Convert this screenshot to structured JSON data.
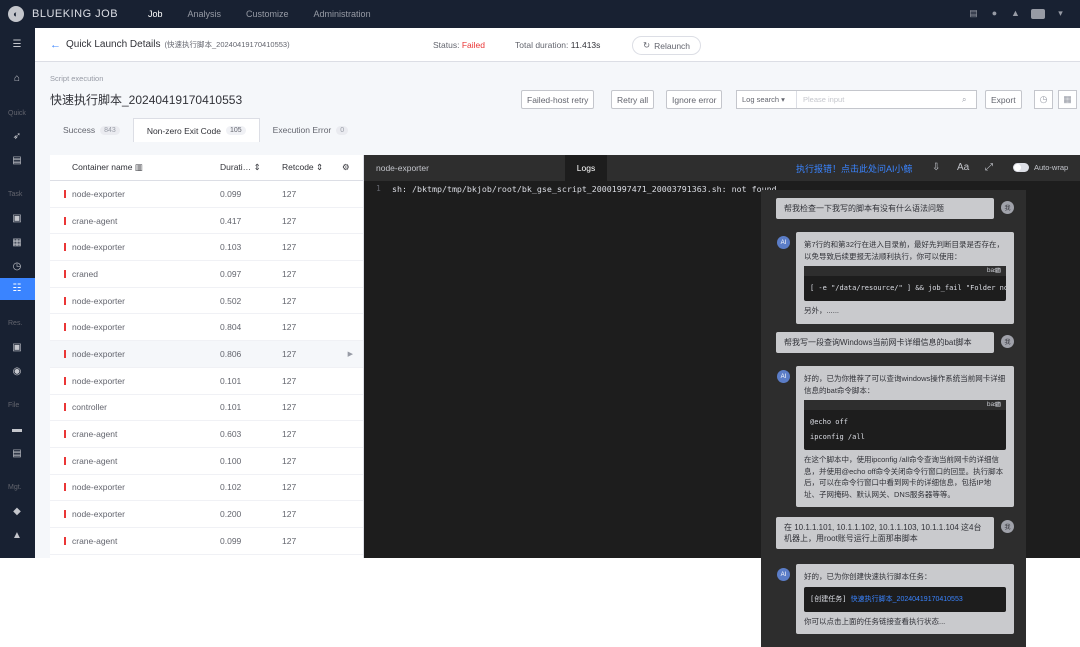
{
  "topbar": {
    "brand": "BLUEKING JOB",
    "nav": [
      "Job",
      "Analysis",
      "Customize",
      "Administration"
    ]
  },
  "sidebar": {
    "groups": [
      "Quick",
      "Task",
      "Res.",
      "File",
      "Mgt."
    ]
  },
  "header": {
    "title": "Quick Launch Details",
    "subtitle": "(快速执行脚本_20240419170410553)",
    "status_label": "Status",
    "status_value": "Failed",
    "duration_label": "Total duration",
    "duration_value": "11.413s",
    "relaunch": "Relaunch"
  },
  "main": {
    "section_label": "Script execution",
    "task_name": "快速执行脚本_20240419170410553",
    "buttons": {
      "failed_retry": "Failed-host retry",
      "retry_all": "Retry all",
      "ignore_error": "Ignore error",
      "export": "Export"
    },
    "log_search": {
      "select": "Log search",
      "placeholder": "Please input"
    },
    "tabs": [
      {
        "label": "Success",
        "count": "843"
      },
      {
        "label": "Non-zero Exit Code",
        "count": "105"
      },
      {
        "label": "Execution Error",
        "count": "0"
      }
    ],
    "table": {
      "headers": [
        "Container name",
        "Durati…",
        "Retcode"
      ],
      "rows": [
        {
          "name": "node-exporter",
          "duration": "0.099",
          "retcode": "127"
        },
        {
          "name": "crane-agent",
          "duration": "0.417",
          "retcode": "127"
        },
        {
          "name": "node-exporter",
          "duration": "0.103",
          "retcode": "127"
        },
        {
          "name": "craned",
          "duration": "0.097",
          "retcode": "127"
        },
        {
          "name": "node-exporter",
          "duration": "0.502",
          "retcode": "127"
        },
        {
          "name": "node-exporter",
          "duration": "0.804",
          "retcode": "127"
        },
        {
          "name": "node-exporter",
          "duration": "0.806",
          "retcode": "127"
        },
        {
          "name": "node-exporter",
          "duration": "0.101",
          "retcode": "127"
        },
        {
          "name": "controller",
          "duration": "0.101",
          "retcode": "127"
        },
        {
          "name": "crane-agent",
          "duration": "0.603",
          "retcode": "127"
        },
        {
          "name": "crane-agent",
          "duration": "0.100",
          "retcode": "127"
        },
        {
          "name": "node-exporter",
          "duration": "0.102",
          "retcode": "127"
        },
        {
          "name": "node-exporter",
          "duration": "0.200",
          "retcode": "127"
        },
        {
          "name": "crane-agent",
          "duration": "0.099",
          "retcode": "127"
        }
      ]
    }
  },
  "log_panel": {
    "host": "node-exporter",
    "tab": "Logs",
    "ai_link": "执行报错！点击此处问AI小鲸",
    "font_btn": "Aa",
    "autowrap": "Auto-wrap",
    "line_no": "1",
    "line": "sh: /bktmp/tmp/bkjob/root/bk_gse_script_20001997471_20003791363.sh: not found"
  },
  "chat": {
    "messages": [
      {
        "role": "user",
        "avatar": "我",
        "text": "帮我检查一下我写的脚本有没有什么语法问题"
      },
      {
        "role": "ai",
        "avatar": "AI",
        "text": "第7行的和第32行在进入目录前，最好先判断目录是否存在，以免导致后续更报无法顺利执行，你可以使用：",
        "code_lang": "bash",
        "code": [
          "[ -e \"/data/resource/\" ] && job_fail \"Folder not exist\""
        ],
        "after": "另外，......"
      },
      {
        "role": "user",
        "avatar": "我",
        "text": "帮我写一段查询Windows当前网卡详细信息的bat脚本"
      },
      {
        "role": "ai",
        "avatar": "AI",
        "text": "好的，已为你推荐了可以查询windows操作系统当前网卡详细信息的bat命令脚本：",
        "code_lang": "bash",
        "code": [
          "@echo off",
          "ipconfig /all"
        ],
        "after": "在这个脚本中，使用ipconfig /all命令查询当前网卡的详细信息，并使用@echo off命令关闭命令行窗口的回显。执行脚本后，可以在命令行窗口中看到网卡的详细信息，包括IP地址、子网掩码、默认网关、DNS服务器等等。"
      },
      {
        "role": "user",
        "avatar": "我",
        "text": "在 10.1.1.101, 10.1.1.102, 10.1.1.103, 10.1.1.104 这4台机器上，用root账号运行上面那串脚本"
      },
      {
        "role": "ai",
        "avatar": "AI",
        "text": "好的，已为你创建快速执行脚本任务：",
        "code_prefix": "[创建任务]",
        "code_link": "快速执行脚本_20240419170410553",
        "after": "你可以点击上面的任务链接查看执行状态..."
      }
    ]
  }
}
